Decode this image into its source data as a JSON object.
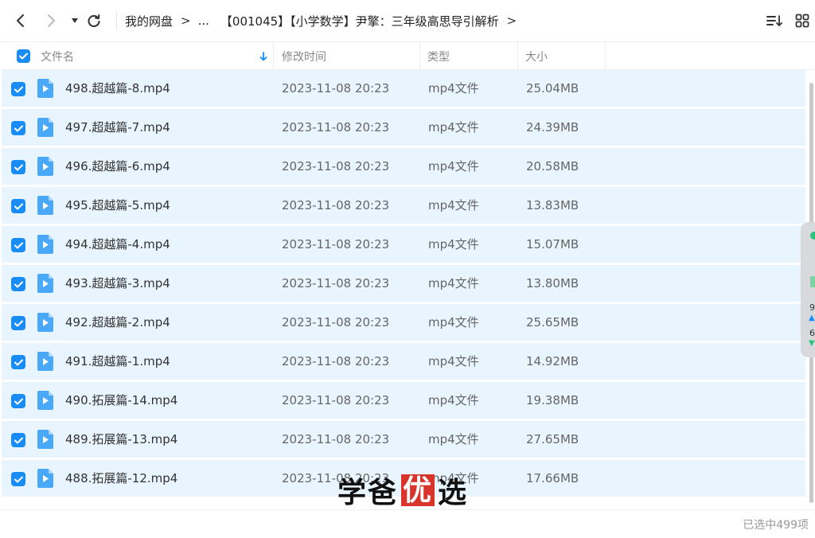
{
  "toolbar": {
    "breadcrumb": [
      "我的网盘",
      "...",
      "【001045】【小学数学】尹擎：三年级高思导引解析"
    ]
  },
  "header": {
    "name": "文件名",
    "modified": "修改时间",
    "type": "类型",
    "size": "大小"
  },
  "files": [
    {
      "name": "498.超越篇-8.mp4",
      "date": "2023-11-08 20:23",
      "type": "mp4文件",
      "size": "25.04MB"
    },
    {
      "name": "497.超越篇-7.mp4",
      "date": "2023-11-08 20:23",
      "type": "mp4文件",
      "size": "24.39MB"
    },
    {
      "name": "496.超越篇-6.mp4",
      "date": "2023-11-08 20:23",
      "type": "mp4文件",
      "size": "20.58MB"
    },
    {
      "name": "495.超越篇-5.mp4",
      "date": "2023-11-08 20:23",
      "type": "mp4文件",
      "size": "13.83MB"
    },
    {
      "name": "494.超越篇-4.mp4",
      "date": "2023-11-08 20:23",
      "type": "mp4文件",
      "size": "15.07MB"
    },
    {
      "name": "493.超越篇-3.mp4",
      "date": "2023-11-08 20:23",
      "type": "mp4文件",
      "size": "13.80MB"
    },
    {
      "name": "492.超越篇-2.mp4",
      "date": "2023-11-08 20:23",
      "type": "mp4文件",
      "size": "25.65MB"
    },
    {
      "name": "491.超越篇-1.mp4",
      "date": "2023-11-08 20:23",
      "type": "mp4文件",
      "size": "14.92MB"
    },
    {
      "name": "490.拓展篇-14.mp4",
      "date": "2023-11-08 20:23",
      "type": "mp4文件",
      "size": "19.38MB"
    },
    {
      "name": "489.拓展篇-13.mp4",
      "date": "2023-11-08 20:23",
      "type": "mp4文件",
      "size": "27.65MB"
    },
    {
      "name": "488.拓展篇-12.mp4",
      "date": "2023-11-08 20:23",
      "type": "mp4文件",
      "size": "17.66MB"
    }
  ],
  "side_widget": {
    "num1": "9",
    "num2": "6"
  },
  "footer": {
    "status": "已选中499项"
  },
  "watermark": {
    "part1": "学爸",
    "part2": "优",
    "part3": "选"
  },
  "colors": {
    "accent": "#1a8cf5",
    "row_selected": "#e8f4fe",
    "file_icon": "#4aa8f8"
  }
}
